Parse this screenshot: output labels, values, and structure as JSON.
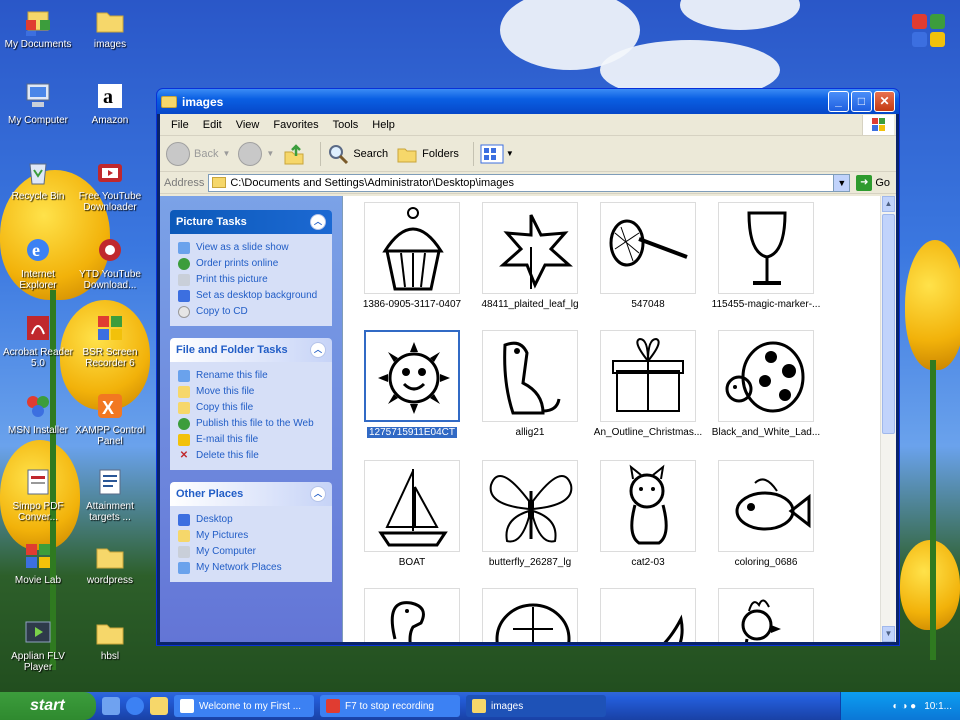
{
  "desktop": {
    "icons": [
      {
        "label": "My Documents"
      },
      {
        "label": "images"
      },
      {
        "label": "My Computer"
      },
      {
        "label": "Amazon"
      },
      {
        "label": "Recycle Bin"
      },
      {
        "label": "Free YouTube Downloader"
      },
      {
        "label": "Internet Explorer"
      },
      {
        "label": "YTD YouTube Download..."
      },
      {
        "label": "Acrobat Reader 5.0"
      },
      {
        "label": "BSR Screen Recorder 6"
      },
      {
        "label": "MSN Installer"
      },
      {
        "label": "XAMPP Control Panel"
      },
      {
        "label": "Simpo PDF Conver..."
      },
      {
        "label": "Attainment targets ..."
      },
      {
        "label": "Movie Lab"
      },
      {
        "label": "wordpress"
      },
      {
        "label": "Applian FLV Player"
      },
      {
        "label": "hbsl"
      }
    ]
  },
  "window": {
    "title": "images",
    "menu": [
      "File",
      "Edit",
      "View",
      "Favorites",
      "Tools",
      "Help"
    ],
    "toolbar": {
      "back": "Back",
      "search": "Search",
      "folders": "Folders"
    },
    "address": {
      "label": "Address",
      "path": "C:\\Documents and Settings\\Administrator\\Desktop\\images",
      "go": "Go"
    },
    "tasks": {
      "picture": {
        "title": "Picture Tasks",
        "items": [
          "View as a slide show",
          "Order prints online",
          "Print this picture",
          "Set as desktop background",
          "Copy to CD"
        ]
      },
      "file": {
        "title": "File and Folder Tasks",
        "items": [
          "Rename this file",
          "Move this file",
          "Copy this file",
          "Publish this file to the Web",
          "E-mail this file",
          "Delete this file"
        ]
      },
      "other": {
        "title": "Other Places",
        "items": [
          "Desktop",
          "My Pictures",
          "My Computer",
          "My Network Places"
        ]
      }
    },
    "files": [
      "1386-0905-3117-0407",
      "48411_plaited_leaf_lg",
      "547048",
      "115455-magic-marker-...",
      "1275715911E04CT",
      "allig21",
      "An_Outline_Christmas...",
      "Black_and_White_Lad...",
      "BOAT",
      "butterfly_26287_lg",
      "cat2-03",
      "coloring_0686"
    ],
    "selected_file": "1275715911E04CT"
  },
  "taskbar": {
    "start": "start",
    "tasks": [
      {
        "label": "Welcome to my First ..."
      },
      {
        "label": "F7 to stop recording"
      },
      {
        "label": "images"
      }
    ],
    "clock": "10:1..."
  },
  "colors": {
    "accent": "#0a5fe3",
    "selection": "#316ac5",
    "taskpane_link": "#215dc6"
  }
}
